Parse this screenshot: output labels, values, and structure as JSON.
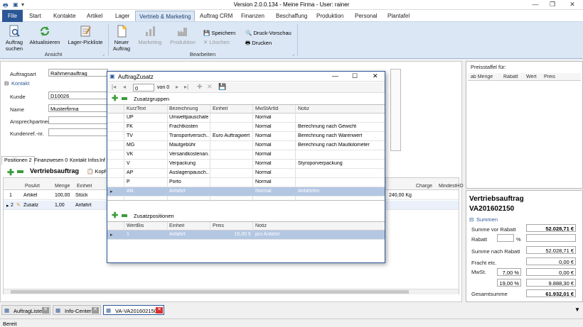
{
  "window": {
    "title": "Version 2.0.0.134 - Meine Firma - User: rainer"
  },
  "menu": [
    "File",
    "Start",
    "Kontakte",
    "Artikel",
    "Lager",
    "Vertrieb & Marketing",
    "Auftrag CRM",
    "Finanzen",
    "Beschaffung",
    "Produktion",
    "Personal",
    "Plantafel"
  ],
  "ribbon": {
    "auftrag_suchen": "Auftrag suchen",
    "aktualisieren": "Aktualisieren",
    "lager_pickliste": "Lager-Pickliste",
    "group_ansicht": "Ansicht",
    "neuer_auftrag": "Neuer Auftrag",
    "marketing": "Marketing",
    "produktion": "Produktion",
    "speichern": "Speichern",
    "loeschen": "Löschen",
    "druck_vorschau": "Druck-Vorschau",
    "drucken": "Drucken",
    "group_bearbeiten": "Bearbeiten"
  },
  "form": {
    "auftragsart_label": "Auftragsart",
    "auftragsart_value": "Rahmenauftrag",
    "kontakt_section": "Kontakt",
    "kunde_label": "Kunde",
    "kunde_value": "D10026",
    "name_label": "Name",
    "name_value": "Musterfirma",
    "ansprechpartner_label": "Ansprechpartner",
    "kundenref_label": "Kundenref.-nr."
  },
  "tabs": [
    "Positionen 2",
    "Finanzwesen 0",
    "Kontakt Infos",
    "Inf"
  ],
  "positions": {
    "toolbar_title": "Vertriebsauftrag",
    "kopf_label": "Kopf-",
    "headers": [
      "PosArt",
      "Menge",
      "Einheit",
      "",
      "Charge",
      "MindestHD"
    ],
    "rows": [
      {
        "nr": "1",
        "posart": "Artikel",
        "menge": "100,00",
        "einheit": "Stück",
        "value": "240,00 Kg"
      },
      {
        "nr": "2",
        "posart": "Zusatz",
        "menge": "1,00",
        "einheit": "Anfahrt",
        "value": ""
      }
    ]
  },
  "dialog": {
    "title": "AuftragZusatz",
    "nav_position": "0",
    "nav_of": "von 0",
    "zusatzgruppen_label": "Zusatzgruppen",
    "headers": [
      "KurzText",
      "Bezeichnung",
      "Einheit",
      "MwStArtId",
      "Notiz"
    ],
    "rows": [
      {
        "kurz": "UP",
        "bez": "Umweltpauschale",
        "einheit": "",
        "mwst": "Normal",
        "notiz": ""
      },
      {
        "kurz": "FK",
        "bez": "Frachtkosten",
        "einheit": "",
        "mwst": "Normal",
        "notiz": "Berechnung nach Gewicht"
      },
      {
        "kurz": "TV",
        "bez": "Transportversich...",
        "einheit": "Euro Auftragwert",
        "mwst": "Normal",
        "notiz": "Berechnung nach Warenwert"
      },
      {
        "kurz": "MG",
        "bez": "Mautgebühr",
        "einheit": "",
        "mwst": "Normal",
        "notiz": "Berechnung nach Mautkilometer"
      },
      {
        "kurz": "VK",
        "bez": "Versandkostenan...",
        "einheit": "",
        "mwst": "Normal",
        "notiz": ""
      },
      {
        "kurz": "V",
        "bez": "Verpackung",
        "einheit": "",
        "mwst": "Normal",
        "notiz": "Styroporverpackung"
      },
      {
        "kurz": "AP",
        "bez": "Auslagenpausch...",
        "einheit": "",
        "mwst": "Normal",
        "notiz": ""
      },
      {
        "kurz": "P",
        "bez": "Porto",
        "einheit": "",
        "mwst": "Normal",
        "notiz": ""
      },
      {
        "kurz": "AN",
        "bez": "Anfahrt",
        "einheit": "",
        "mwst": "Normal",
        "notiz": "Anfahrten"
      }
    ],
    "zusatzpositionen_label": "Zusatzpositionen",
    "pos_headers": [
      "WertBis",
      "Einheit",
      "Preis",
      "Notiz"
    ],
    "pos_rows": [
      {
        "wertbis": "1",
        "einheit": "Anfahrt",
        "preis": "15,00 €",
        "notiz": "pro Anfahrt"
      }
    ]
  },
  "preisstaffel": {
    "title": "Preisstaffel für:",
    "headers": [
      "ab Menge",
      "Rabatt",
      "Wert",
      "Preis"
    ]
  },
  "summary": {
    "title": "Vertriebsauftrag",
    "number": "VA201602150",
    "summen_label": "Summen",
    "summe_vor_rabatt_label": "Summe vor Rabatt",
    "summe_vor_rabatt": "52.028,71 €",
    "rabatt_label": "Rabatt",
    "percent_sign": "%",
    "summe_nach_rabatt_label": "Summe nach Rabatt",
    "summe_nach_rabatt": "52.028,71 €",
    "fracht_label": "Fracht etc.",
    "fracht": "0,00 €",
    "mwst_label": "MwSt.",
    "mwst1_pct": "7,00 %",
    "mwst1_val": "0,00 €",
    "mwst2_pct": "19,00 %",
    "mwst2_val": "9.888,30 €",
    "gesamt_label": "Gesamtsumme",
    "gesamt": "61.932,01 €"
  },
  "doctabs": [
    "AuftragListe",
    "Info-Center",
    "VA-VA201602150"
  ],
  "status": "Bereit",
  "colors": {
    "accent": "#2b5797",
    "ribbon": "#dbe7f5",
    "selected_row": "#b3c7e3",
    "close_red": "#d9302f"
  }
}
